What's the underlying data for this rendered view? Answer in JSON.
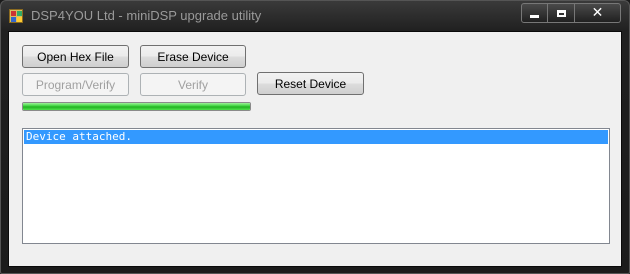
{
  "window": {
    "title": "DSP4YOU Ltd - miniDSP upgrade utility",
    "icon": "app-icon",
    "controls": {
      "minimize": "minimize-icon",
      "maximize": "maximize-icon",
      "close": "close-icon"
    }
  },
  "buttons": {
    "open_hex_file": "Open Hex File",
    "erase_device": "Erase Device",
    "program_verify": "Program/Verify",
    "verify": "Verify",
    "reset_device": "Reset Device"
  },
  "progress": {
    "fraction": 1.0,
    "color": "#2ecc40"
  },
  "log": {
    "items": [
      {
        "text": "Device attached.",
        "selected": true
      }
    ]
  },
  "colors": {
    "selection": "#3399ff",
    "client_background": "#f0f0f0"
  }
}
